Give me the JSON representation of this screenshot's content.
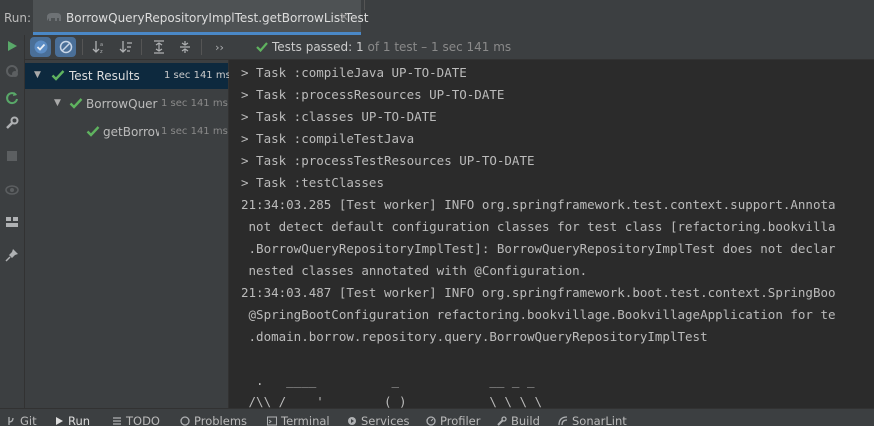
{
  "tabbar": {
    "run_label": "Run:",
    "tab_title": "BorrowQueryRepositoryImplTest.getBorrowListTest",
    "close_glyph": "✕"
  },
  "toolbar": {
    "more_glyph": "››",
    "status_passed": "Tests passed: ",
    "status_count": "1",
    "status_detail": " of 1 test – 1 sec 141 ms"
  },
  "tree": {
    "items": [
      {
        "label": "Test Results",
        "time": "1 sec 141 ms",
        "status": "passed",
        "expanded": true,
        "selected": true
      },
      {
        "label": "BorrowQuery",
        "time": "1 sec 141 ms",
        "status": "passed",
        "expanded": true,
        "selected": false
      },
      {
        "label": "getBorrow",
        "time": "1 sec 141 ms",
        "status": "passed",
        "selected": false
      }
    ]
  },
  "console": {
    "lines": [
      "> Task :compileJava UP-TO-DATE",
      "> Task :processResources UP-TO-DATE",
      "> Task :classes UP-TO-DATE",
      "> Task :compileTestJava",
      "> Task :processTestResources UP-TO-DATE",
      "> Task :testClasses",
      "21:34:03.285 [Test worker] INFO org.springframework.test.context.support.Annota",
      " not detect default configuration classes for test class [refactoring.bookvilla",
      " .BorrowQueryRepositoryImplTest]: BorrowQueryRepositoryImplTest does not declar",
      " nested classes annotated with @Configuration.",
      "21:34:03.487 [Test worker] INFO org.springframework.boot.test.context.SpringBoo",
      " @SpringBootConfiguration refactoring.bookvillage.BookvillageApplication for te",
      " .domain.borrow.repository.query.BorrowQueryRepositoryImplTest",
      "",
      "",
      "  .   ____          _            __ _ _",
      " /\\\\ / ___'_ __ _ _(_)_ __  __ _ \\ \\ \\ \\"
    ]
  },
  "bottombar": {
    "items": [
      {
        "label": "Git",
        "icon": "git-branch-icon"
      },
      {
        "label": "Run",
        "icon": "run-icon"
      },
      {
        "label": "TODO",
        "icon": "todo-icon"
      },
      {
        "label": "Problems",
        "icon": "problems-icon"
      },
      {
        "label": "Terminal",
        "icon": "terminal-icon"
      },
      {
        "label": "Services",
        "icon": "services-icon"
      },
      {
        "label": "Profiler",
        "icon": "profiler-icon"
      },
      {
        "label": "Build",
        "icon": "build-icon"
      },
      {
        "label": "SonarLint",
        "icon": "sonarlint-icon"
      }
    ]
  },
  "colors": {
    "pass_green": "#5fb35f",
    "accent_blue": "#4a88c7",
    "selection": "#0d293e",
    "panel": "#3c3f41",
    "editor": "#2b2b2b"
  }
}
